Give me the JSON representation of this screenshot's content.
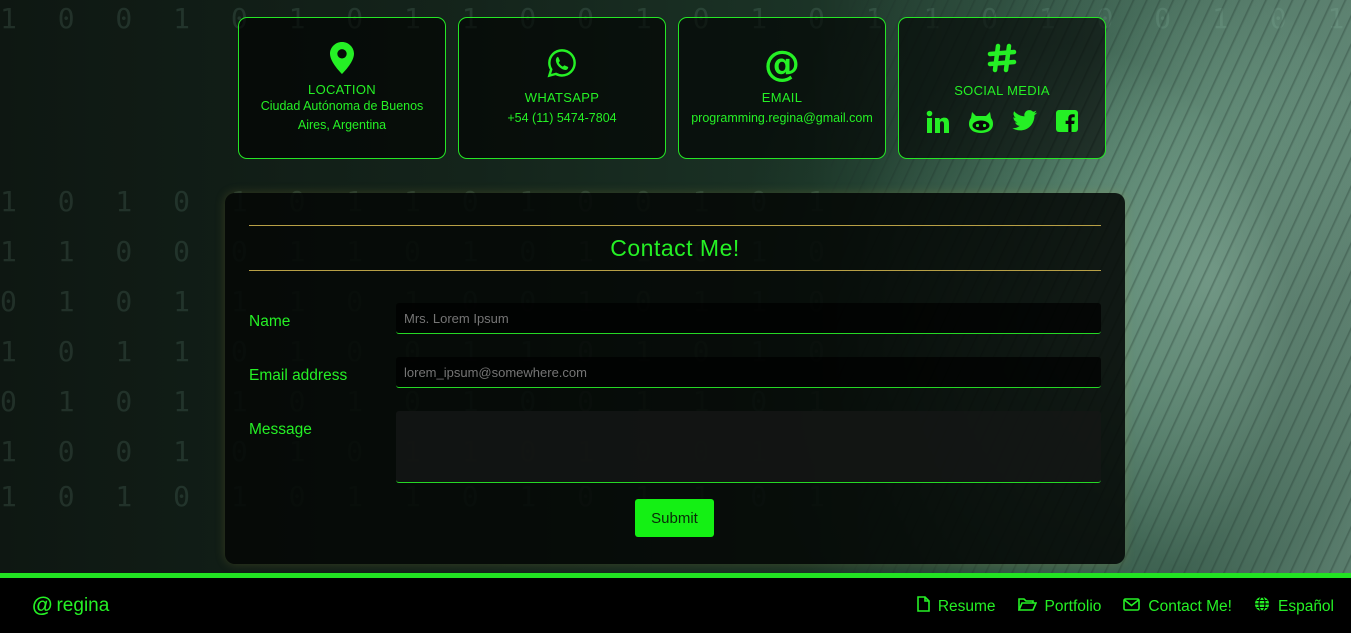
{
  "colors": {
    "accent": "#25f025",
    "panel": "#050806",
    "divider": "#b8a046",
    "submit_bg": "#14f014"
  },
  "contact_cards": [
    {
      "icon": "map-pin-icon",
      "title": "LOCATION",
      "text": "Ciudad Autónoma de Buenos Aires, Argentina"
    },
    {
      "icon": "whatsapp-icon",
      "title": "WHATSAPP",
      "text": "+54 (11) 5474-7804"
    },
    {
      "icon": "at-sign-icon",
      "title": "EMAIL",
      "text": "programming.regina@gmail.com"
    },
    {
      "icon": "hashtag-icon",
      "title": "SOCIAL MEDIA",
      "links": [
        "linkedin-icon",
        "github-icon",
        "twitter-icon",
        "facebook-icon"
      ]
    }
  ],
  "form": {
    "title": "Contact Me!",
    "name_label": "Name",
    "name_placeholder": "Mrs. Lorem Ipsum",
    "email_label": "Email address",
    "email_placeholder": "lorem_ipsum@somewhere.com",
    "message_label": "Message",
    "message_value": "",
    "submit_label": "Submit"
  },
  "footer": {
    "brand_symbol": "@",
    "brand_name": "regina",
    "nav": [
      {
        "icon": "file-icon",
        "label": "Resume"
      },
      {
        "icon": "folder-open-icon",
        "label": "Portfolio"
      },
      {
        "icon": "envelope-icon",
        "label": "Contact Me!"
      },
      {
        "icon": "globe-icon",
        "label": "Español"
      }
    ]
  }
}
